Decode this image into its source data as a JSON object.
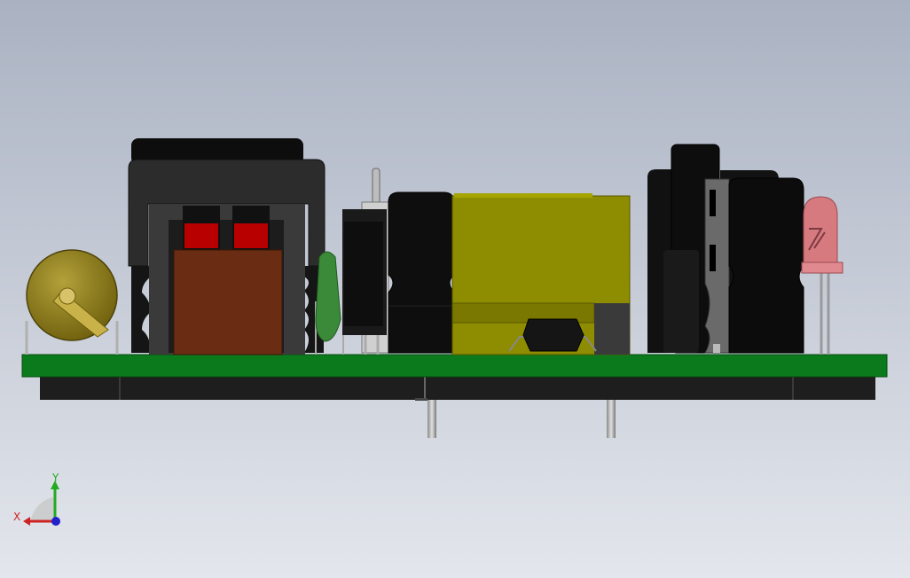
{
  "viewport": {
    "background_top": "#aab2c2",
    "background_bottom": "#e3e6ec"
  },
  "triad": {
    "x_label": "X",
    "y_label": "Y",
    "x_color": "#cc2222",
    "y_color": "#22aa22",
    "z_color": "#2222cc"
  },
  "colors": {
    "pcb_green": "#0b7a1c",
    "component_black": "#111111",
    "transformer_yellow": "#8e8c00",
    "ferrite_dark": "#2e2e2e",
    "winding_brown": "#6a2c12",
    "winding_red": "#b80000",
    "varistor_olive": "#8a7a14",
    "led_pink": "#d67a80",
    "small_cap_green": "#3a8a3a",
    "pin_gray": "#b8b8b8"
  }
}
